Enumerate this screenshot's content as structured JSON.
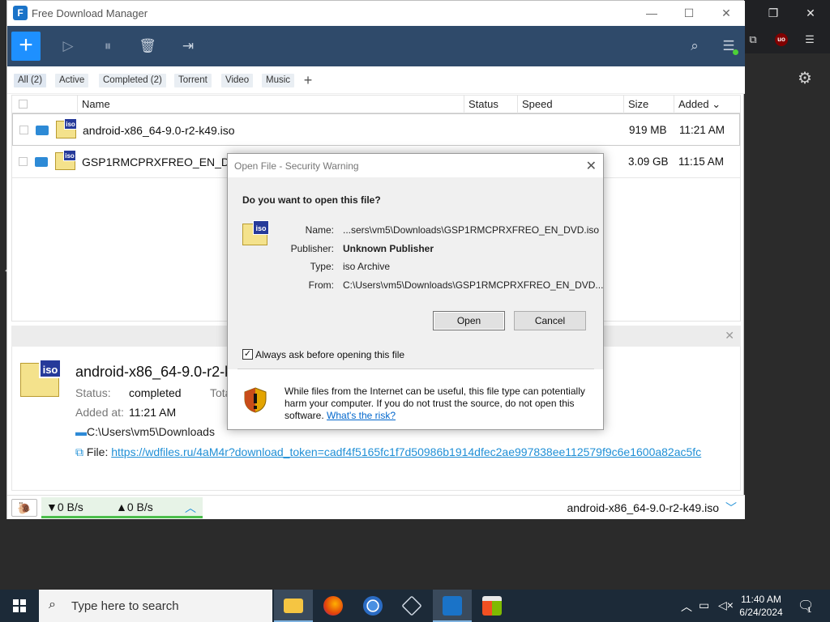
{
  "app": {
    "title": "Free Download Manager",
    "logo_letter": "F",
    "window_controls": {
      "minimize": "—",
      "maximize": "☐",
      "close": "✕"
    }
  },
  "toolbar": {
    "add_label": "+",
    "icons": [
      "resume-icon",
      "pause-icon",
      "delete-icon",
      "move-icon",
      "search-icon",
      "menu-icon"
    ],
    "accent": "#1e90ff",
    "bg": "#2f4a6a"
  },
  "filters": [
    {
      "label": "All (2)",
      "selected": true
    },
    {
      "label": "Active",
      "selected": false
    },
    {
      "label": "Completed (2)",
      "selected": false
    },
    {
      "label": "Torrent",
      "selected": false
    },
    {
      "label": "Video",
      "selected": false
    },
    {
      "label": "Music",
      "selected": false
    }
  ],
  "filter_add": "+",
  "table": {
    "columns": [
      "Name",
      "Status",
      "Speed",
      "Size",
      "Added"
    ],
    "added_sort_indicator": "⌄",
    "rows": [
      {
        "name": "android-x86_64-9.0-r2-k49.iso",
        "status": "",
        "speed": "",
        "size": "919 MB",
        "added": "11:21 AM"
      },
      {
        "name": "GSP1RMCPRXFREO_EN_DVD.iso",
        "status": "",
        "speed": "",
        "size": "3.09 GB",
        "added": "11:15 AM"
      }
    ]
  },
  "details": {
    "name": "android-x86_64-9.0-r2-k49.iso",
    "status_label": "Status:",
    "status_value": "completed",
    "total_label": "Total",
    "added_label": "Added at:",
    "added_value": "11:21 AM",
    "path": "C:\\Users\\vm5\\Downloads",
    "file_label": "File:",
    "file_url": "https://wdfiles.ru/4aM4r?download_token=cadf4f5165fc1f7d50986b1914dfec2ae997838ee112579f9c6e1600a82ac5fc"
  },
  "statusbar": {
    "down_speed": "▼0 B/s",
    "up_speed": "▲0 B/s",
    "current_file": "android-x86_64-9.0-r2-k49.iso"
  },
  "dialog": {
    "title": "Open File - Security Warning",
    "question": "Do you want to open this file?",
    "fields": [
      {
        "label": "Name:",
        "value": "...sers\\vm5\\Downloads\\GSP1RMCPRXFREO_EN_DVD.iso",
        "bold": false
      },
      {
        "label": "Publisher:",
        "value": "Unknown Publisher",
        "bold": true
      },
      {
        "label": "Type:",
        "value": "iso Archive",
        "bold": false
      },
      {
        "label": "From:",
        "value": "C:\\Users\\vm5\\Downloads\\GSP1RMCPRXFREO_EN_DVD...",
        "bold": false
      }
    ],
    "open_label": "Open",
    "cancel_label": "Cancel",
    "checkbox_label": "Always ask before opening this file",
    "checkbox_checked": true,
    "warning_text": "While files from the Internet can be useful, this file type can potentially harm your computer. If you do not trust the source, do not open this software.",
    "risk_link": "What's the risk?"
  },
  "taskbar": {
    "search_placeholder": "Type here to search",
    "apps": [
      "file-explorer",
      "firefox",
      "chrome",
      "virtualbox",
      "free-download-manager",
      "store"
    ],
    "clock_time": "11:40 AM",
    "clock_date": "6/24/2024",
    "notification_count": "1"
  }
}
